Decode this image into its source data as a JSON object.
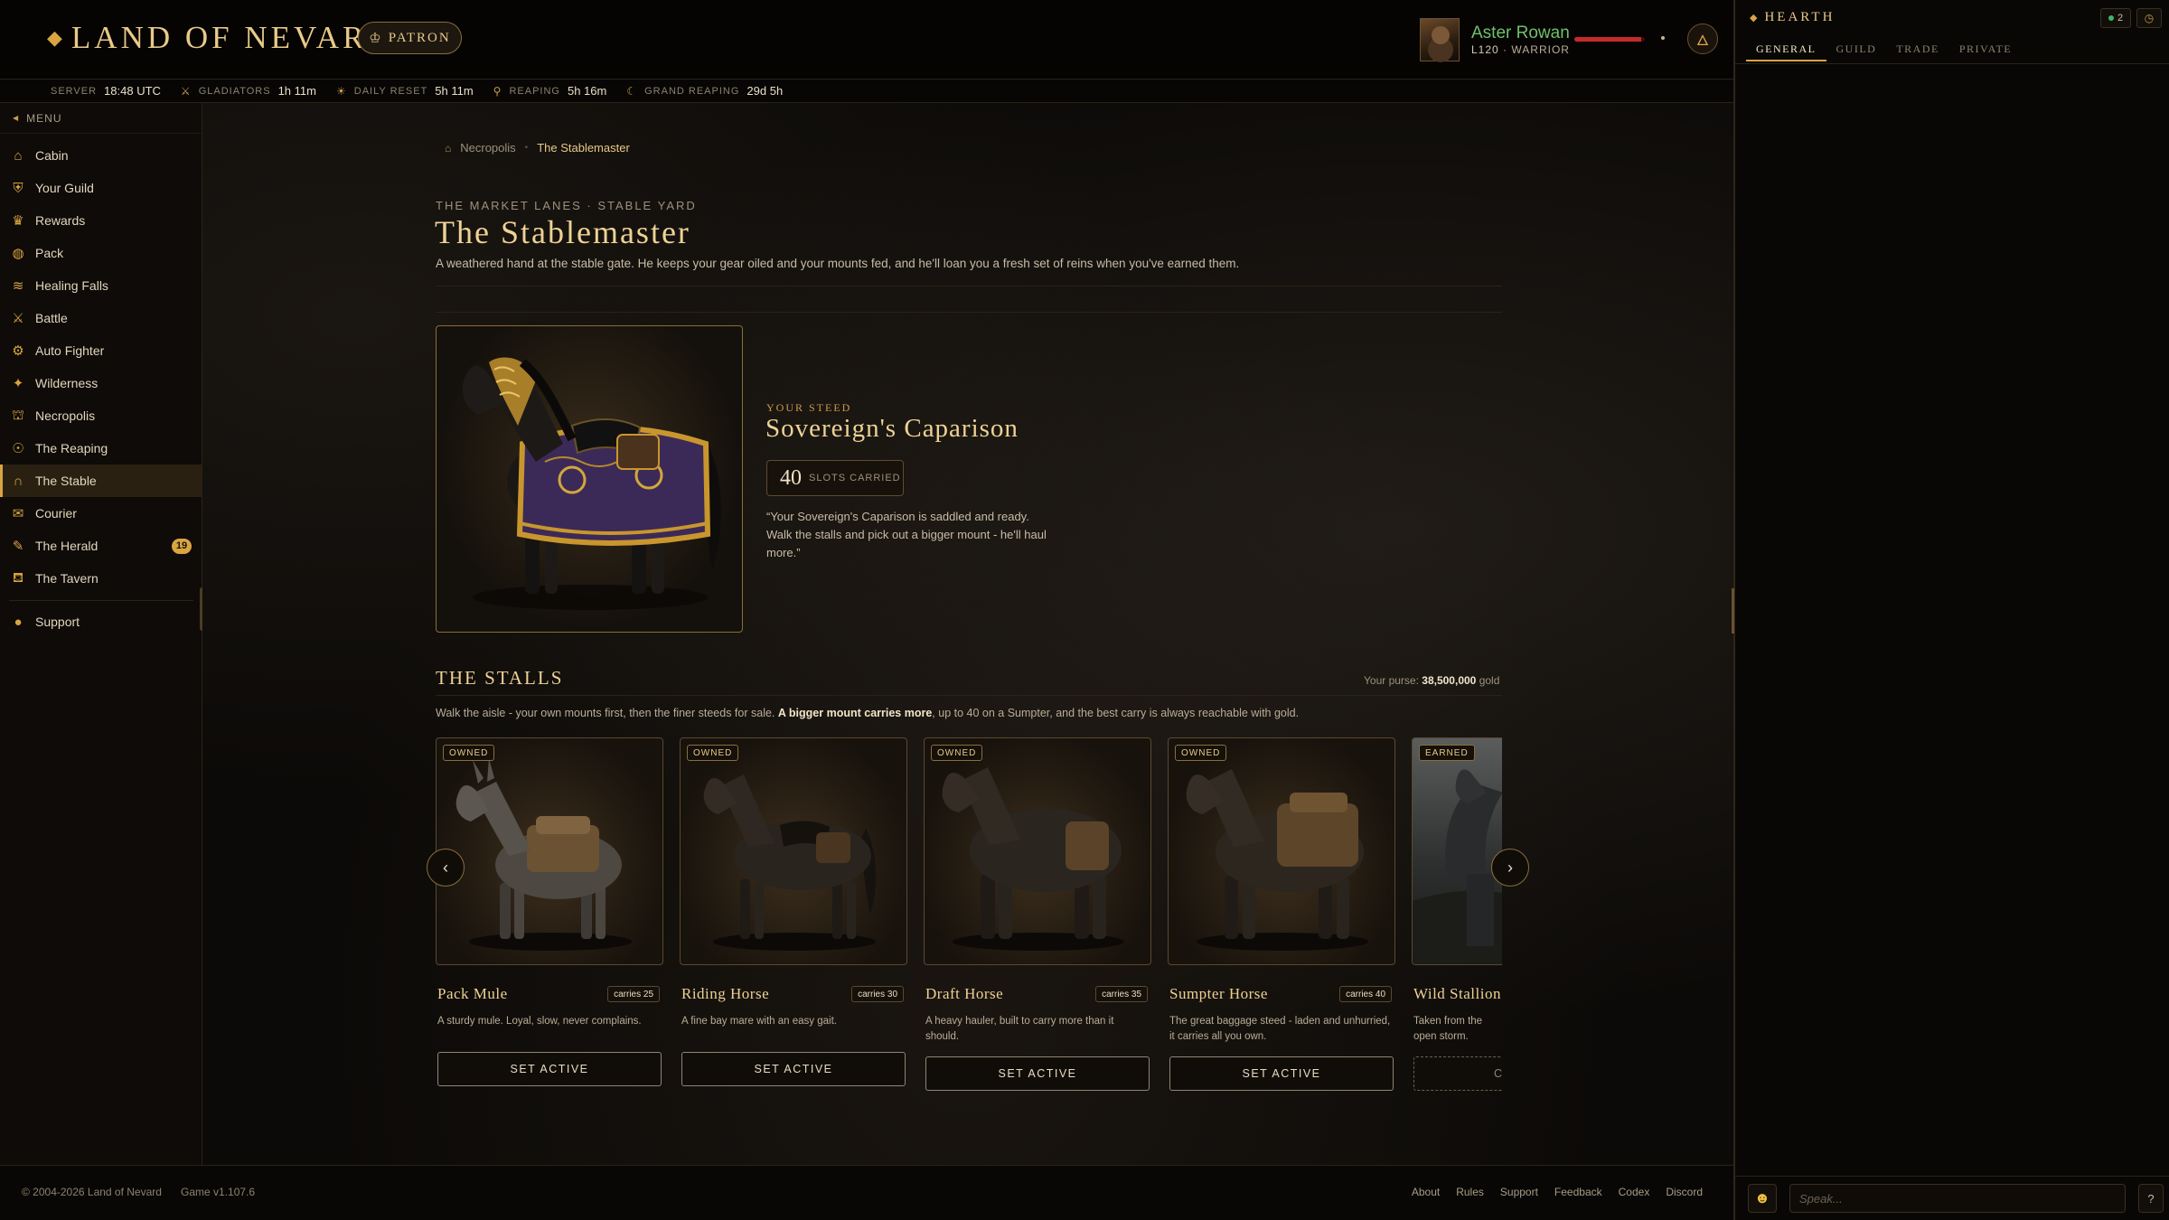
{
  "app": {
    "logo": "LAND OF NEVARD",
    "patron_label": "PATRON"
  },
  "player": {
    "name": "Aster Rowan",
    "level": "L120",
    "class": "WARRIOR",
    "hp_fraction": 0.95
  },
  "timers": [
    {
      "label": "SERVER",
      "value": "18:48 UTC",
      "icon": ""
    },
    {
      "label": "GLADIATORS",
      "value": "1h 11m",
      "icon": "crossed-swords-icon"
    },
    {
      "label": "DAILY RESET",
      "value": "5h 11m",
      "icon": "sun-icon"
    },
    {
      "label": "REAPING",
      "value": "5h 16m",
      "icon": "scythe-icon"
    },
    {
      "label": "GRAND REAPING",
      "value": "29d 5h",
      "icon": "moon-icon"
    }
  ],
  "sidebar": {
    "menu_label": "MENU",
    "items": [
      {
        "label": "Cabin",
        "icon": "cabin-icon"
      },
      {
        "label": "Your Guild",
        "icon": "guild-icon"
      },
      {
        "label": "Rewards",
        "icon": "rewards-icon"
      },
      {
        "label": "Pack",
        "icon": "pack-icon"
      },
      {
        "label": "Healing Falls",
        "icon": "falls-icon"
      },
      {
        "label": "Battle",
        "icon": "battle-icon"
      },
      {
        "label": "Auto Fighter",
        "icon": "gear-icon"
      },
      {
        "label": "Wilderness",
        "icon": "compass-icon"
      },
      {
        "label": "Necropolis",
        "icon": "necropolis-icon"
      },
      {
        "label": "The Reaping",
        "icon": "reaping-icon"
      },
      {
        "label": "The Stable",
        "icon": "horseshoe-icon",
        "active": true
      },
      {
        "label": "Courier",
        "icon": "courier-icon"
      },
      {
        "label": "The Herald",
        "icon": "herald-icon",
        "badge": "19"
      },
      {
        "label": "The Tavern",
        "icon": "tavern-icon"
      }
    ],
    "support_label": "Support"
  },
  "breadcrumb": {
    "parent": "Necropolis",
    "current": "The Stablemaster"
  },
  "header": {
    "eyebrow": "THE MARKET LANES · STABLE YARD",
    "title": "The Stablemaster",
    "description": "A weathered hand at the stable gate. He keeps your gear oiled and your mounts fed, and he'll loan you a fresh set of reins when you've earned them."
  },
  "steed": {
    "label": "YOUR STEED",
    "name": "Sovereign's Caparison",
    "slots": "40",
    "slots_label": "SLOTS CARRIED",
    "quote": "“Your Sovereign's Caparison is saddled and ready. Walk the stalls and pick out a bigger mount - he'll haul more.”"
  },
  "stalls": {
    "title": "THE STALLS",
    "purse_label": "Your purse:",
    "purse_amount": "38,500,000",
    "purse_unit": "gold",
    "desc_pre": "Walk the aisle - your own mounts first, then the finer steeds for sale. ",
    "desc_bold": "A bigger mount carries more",
    "desc_post": ", up to 40 on a Sumpter, and the best carry is always reachable with gold.",
    "cards": [
      {
        "status": "OWNED",
        "name": "Pack Mule",
        "carries": "carries 25",
        "desc": "A sturdy mule. Loyal, slow, never complains.",
        "button": "SET ACTIVE"
      },
      {
        "status": "OWNED",
        "name": "Riding Horse",
        "carries": "carries 30",
        "desc": "A fine bay mare with an easy gait.",
        "button": "SET ACTIVE"
      },
      {
        "status": "OWNED",
        "name": "Draft Horse",
        "carries": "carries 35",
        "desc": "A heavy hauler, built to carry more than it should.",
        "button": "SET ACTIVE"
      },
      {
        "status": "OWNED",
        "name": "Sumpter Horse",
        "carries": "carries 40",
        "desc": "The great baggage steed - laden and unhurried, it carries all you own.",
        "button": "SET ACTIVE"
      },
      {
        "status": "EARNED",
        "name": "Wild Stallion",
        "carries": "",
        "desc": "Taken from the open storm.",
        "button": "C"
      }
    ]
  },
  "footer": {
    "copyright": "© 2004-2026 Land of Nevard",
    "version": "Game v1.107.6",
    "links": [
      "About",
      "Rules",
      "Support",
      "Feedback",
      "Codex",
      "Discord"
    ]
  },
  "chat": {
    "title": "HEARTH",
    "online_count": "2",
    "tabs": [
      "GENERAL",
      "GUILD",
      "TRADE",
      "PRIVATE"
    ],
    "active_tab": 0,
    "input_placeholder": "Speak...",
    "help_label": "?"
  },
  "colors": {
    "accent": "#d9a441",
    "title_gold": "#eed295",
    "hp_red": "#c42b2b",
    "online_green": "#3fb56a",
    "player_name": "#6fc06b"
  }
}
